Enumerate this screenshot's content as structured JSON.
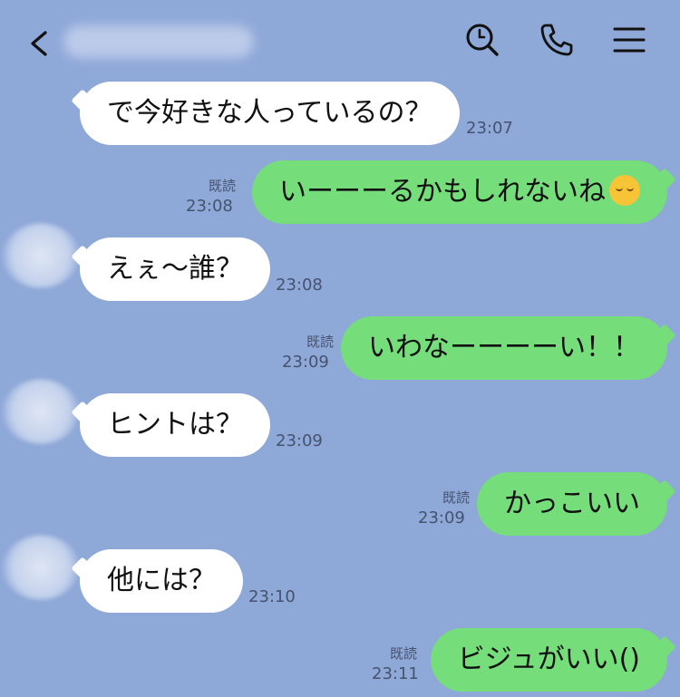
{
  "header": {
    "back_icon": "chevron-left-icon",
    "search_icon": "search-icon",
    "call_icon": "phone-icon",
    "menu_icon": "menu-icon"
  },
  "messages": [
    {
      "side": "left",
      "text": "で今好きな人っているの？",
      "time": "23:07"
    },
    {
      "side": "right",
      "text": "いーーーるかもしれないね",
      "emoji": "relieved-face-emoji",
      "time": "23:08",
      "read": "既読"
    },
    {
      "side": "left",
      "text": "えぇ〜誰？",
      "time": "23:08"
    },
    {
      "side": "right",
      "text": "いわなーーーーい！！",
      "time": "23:09",
      "read": "既読"
    },
    {
      "side": "left",
      "text": "ヒントは？",
      "time": "23:09"
    },
    {
      "side": "right",
      "text": "かっこいい",
      "time": "23:09",
      "read": "既読"
    },
    {
      "side": "left",
      "text": "他には？",
      "time": "23:10"
    },
    {
      "side": "right",
      "text": "ビジュがいい()",
      "time": "23:11",
      "read": "既読"
    }
  ],
  "colors": {
    "background": "#8ea8d8",
    "outgoing_bubble": "#75dd7a",
    "incoming_bubble": "#ffffff"
  }
}
